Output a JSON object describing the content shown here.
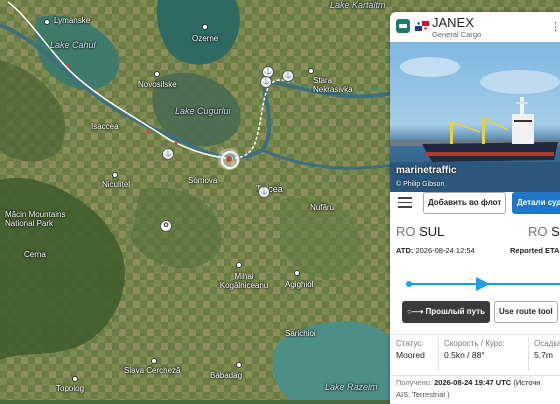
{
  "map": {
    "places": [
      {
        "name": "Lymanske",
        "cls": "town"
      },
      {
        "name": "Lake Cahul",
        "cls": "water"
      },
      {
        "name": "Ozerne",
        "cls": "town"
      },
      {
        "name": "Novosilske",
        "cls": "town"
      },
      {
        "name": "Lake Cugurlui",
        "cls": "water"
      },
      {
        "name": "Stara Nekrasivka",
        "cls": "town"
      },
      {
        "name": "Isaccea",
        "cls": "town"
      },
      {
        "name": "Niculițel",
        "cls": "town"
      },
      {
        "name": "Somova",
        "cls": "town"
      },
      {
        "name": "Tulcea",
        "cls": "town"
      },
      {
        "name": "Nufăru",
        "cls": "town"
      },
      {
        "name": "Măcin Mountains National Park",
        "cls": "park"
      },
      {
        "name": "Cerna",
        "cls": "town"
      },
      {
        "name": "Mihai Kogălniceanu",
        "cls": "town"
      },
      {
        "name": "Agighiol",
        "cls": "town"
      },
      {
        "name": "Sarichioi",
        "cls": "town"
      },
      {
        "name": "Slava Cercheză",
        "cls": "town"
      },
      {
        "name": "Babadag",
        "cls": "town"
      },
      {
        "name": "Topolog",
        "cls": "town"
      },
      {
        "name": "Lake Razelm",
        "cls": "water"
      },
      {
        "name": "Lake Kartaltm",
        "cls": "water"
      }
    ]
  },
  "vessel": {
    "name": "JANEX",
    "type": "General Cargo",
    "flag_colors": [
      "#d21034",
      "#ffffff",
      "#1a3c8c"
    ],
    "photo_watermark": "marinetraffic",
    "photo_credit": "© Philip Gibson"
  },
  "actions": {
    "menu_icon": "hamburger-icon",
    "add_to_fleet": "Добавить во флот",
    "details": "Детали суд",
    "past_route": "Прошлый путь",
    "route_tool": "Use route tool"
  },
  "voyage": {
    "departure": {
      "country": "RO",
      "port": "SUL"
    },
    "destination": {
      "country": "RO",
      "port": "S"
    },
    "atd_label": "ATD:",
    "atd_value": "2026-08-24 12:54",
    "eta_label": "Reported ETA",
    "progress": 0.5
  },
  "status": {
    "status_label": "Статус:",
    "status_value": "Moored",
    "speed_label": "Скорость / Курс:",
    "speed_value": "0.5kn / 88°",
    "draught_label": "Осадка",
    "draught_value": "5.7m"
  },
  "received": {
    "label": "Получено:",
    "value": "2026-08-24 19:47 UTC",
    "source_suffix": "(Источн",
    "ais": "AIS: Terrestrial )"
  },
  "colors": {
    "accent": "#1f77c9",
    "route": "#1f9ee8"
  }
}
